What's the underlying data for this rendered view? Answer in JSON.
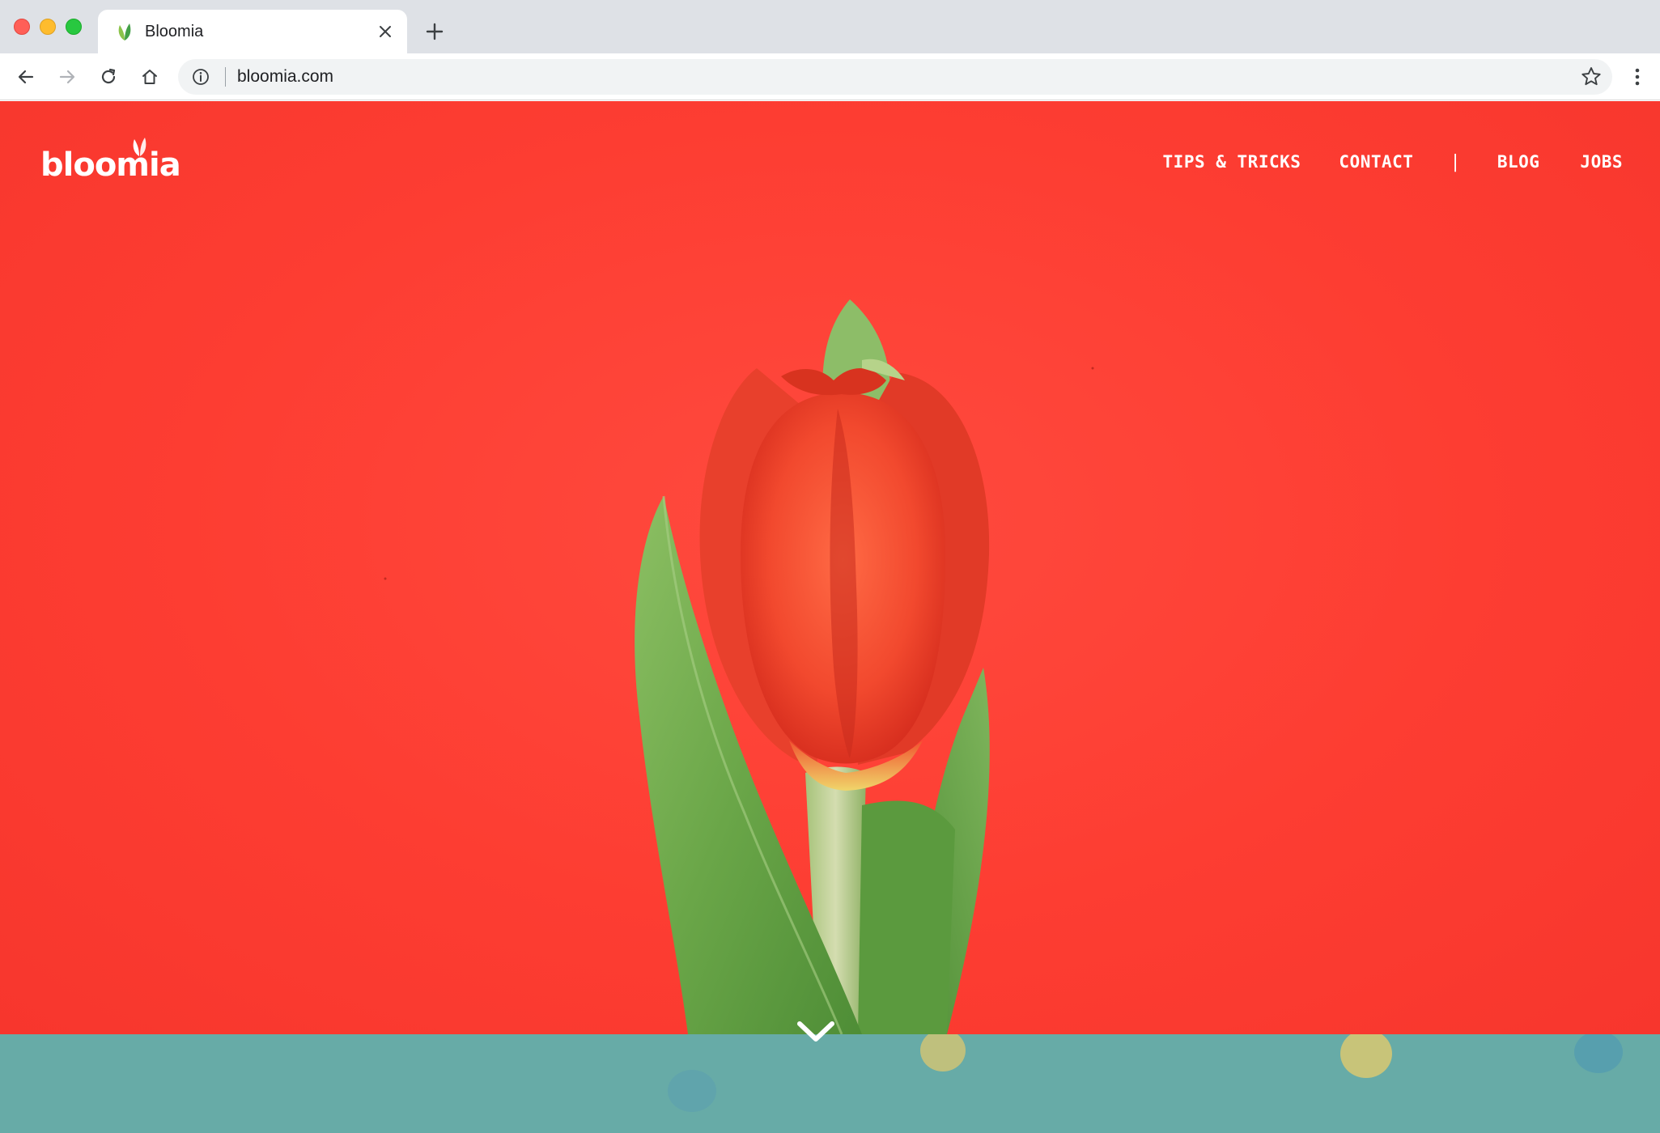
{
  "browser": {
    "tab_title": "Bloomia",
    "url": "bloomia.com",
    "icons": {
      "close": "close-icon",
      "new_tab": "plus-icon",
      "back": "arrow-left-icon",
      "forward": "arrow-right-icon",
      "reload": "reload-icon",
      "home": "home-icon",
      "info": "info-icon",
      "bookmark": "star-icon",
      "menu": "kebab-menu-icon"
    }
  },
  "site": {
    "logo_text": "bloomia",
    "nav": {
      "tips": "TIPS & TRICKS",
      "contact": "CONTACT",
      "separator": "|",
      "blog": "BLOG",
      "jobs": "JOBS"
    },
    "colors": {
      "hero_background": "#fc3d34",
      "band": "#67aba7",
      "brand_green": "#4caf50"
    }
  }
}
